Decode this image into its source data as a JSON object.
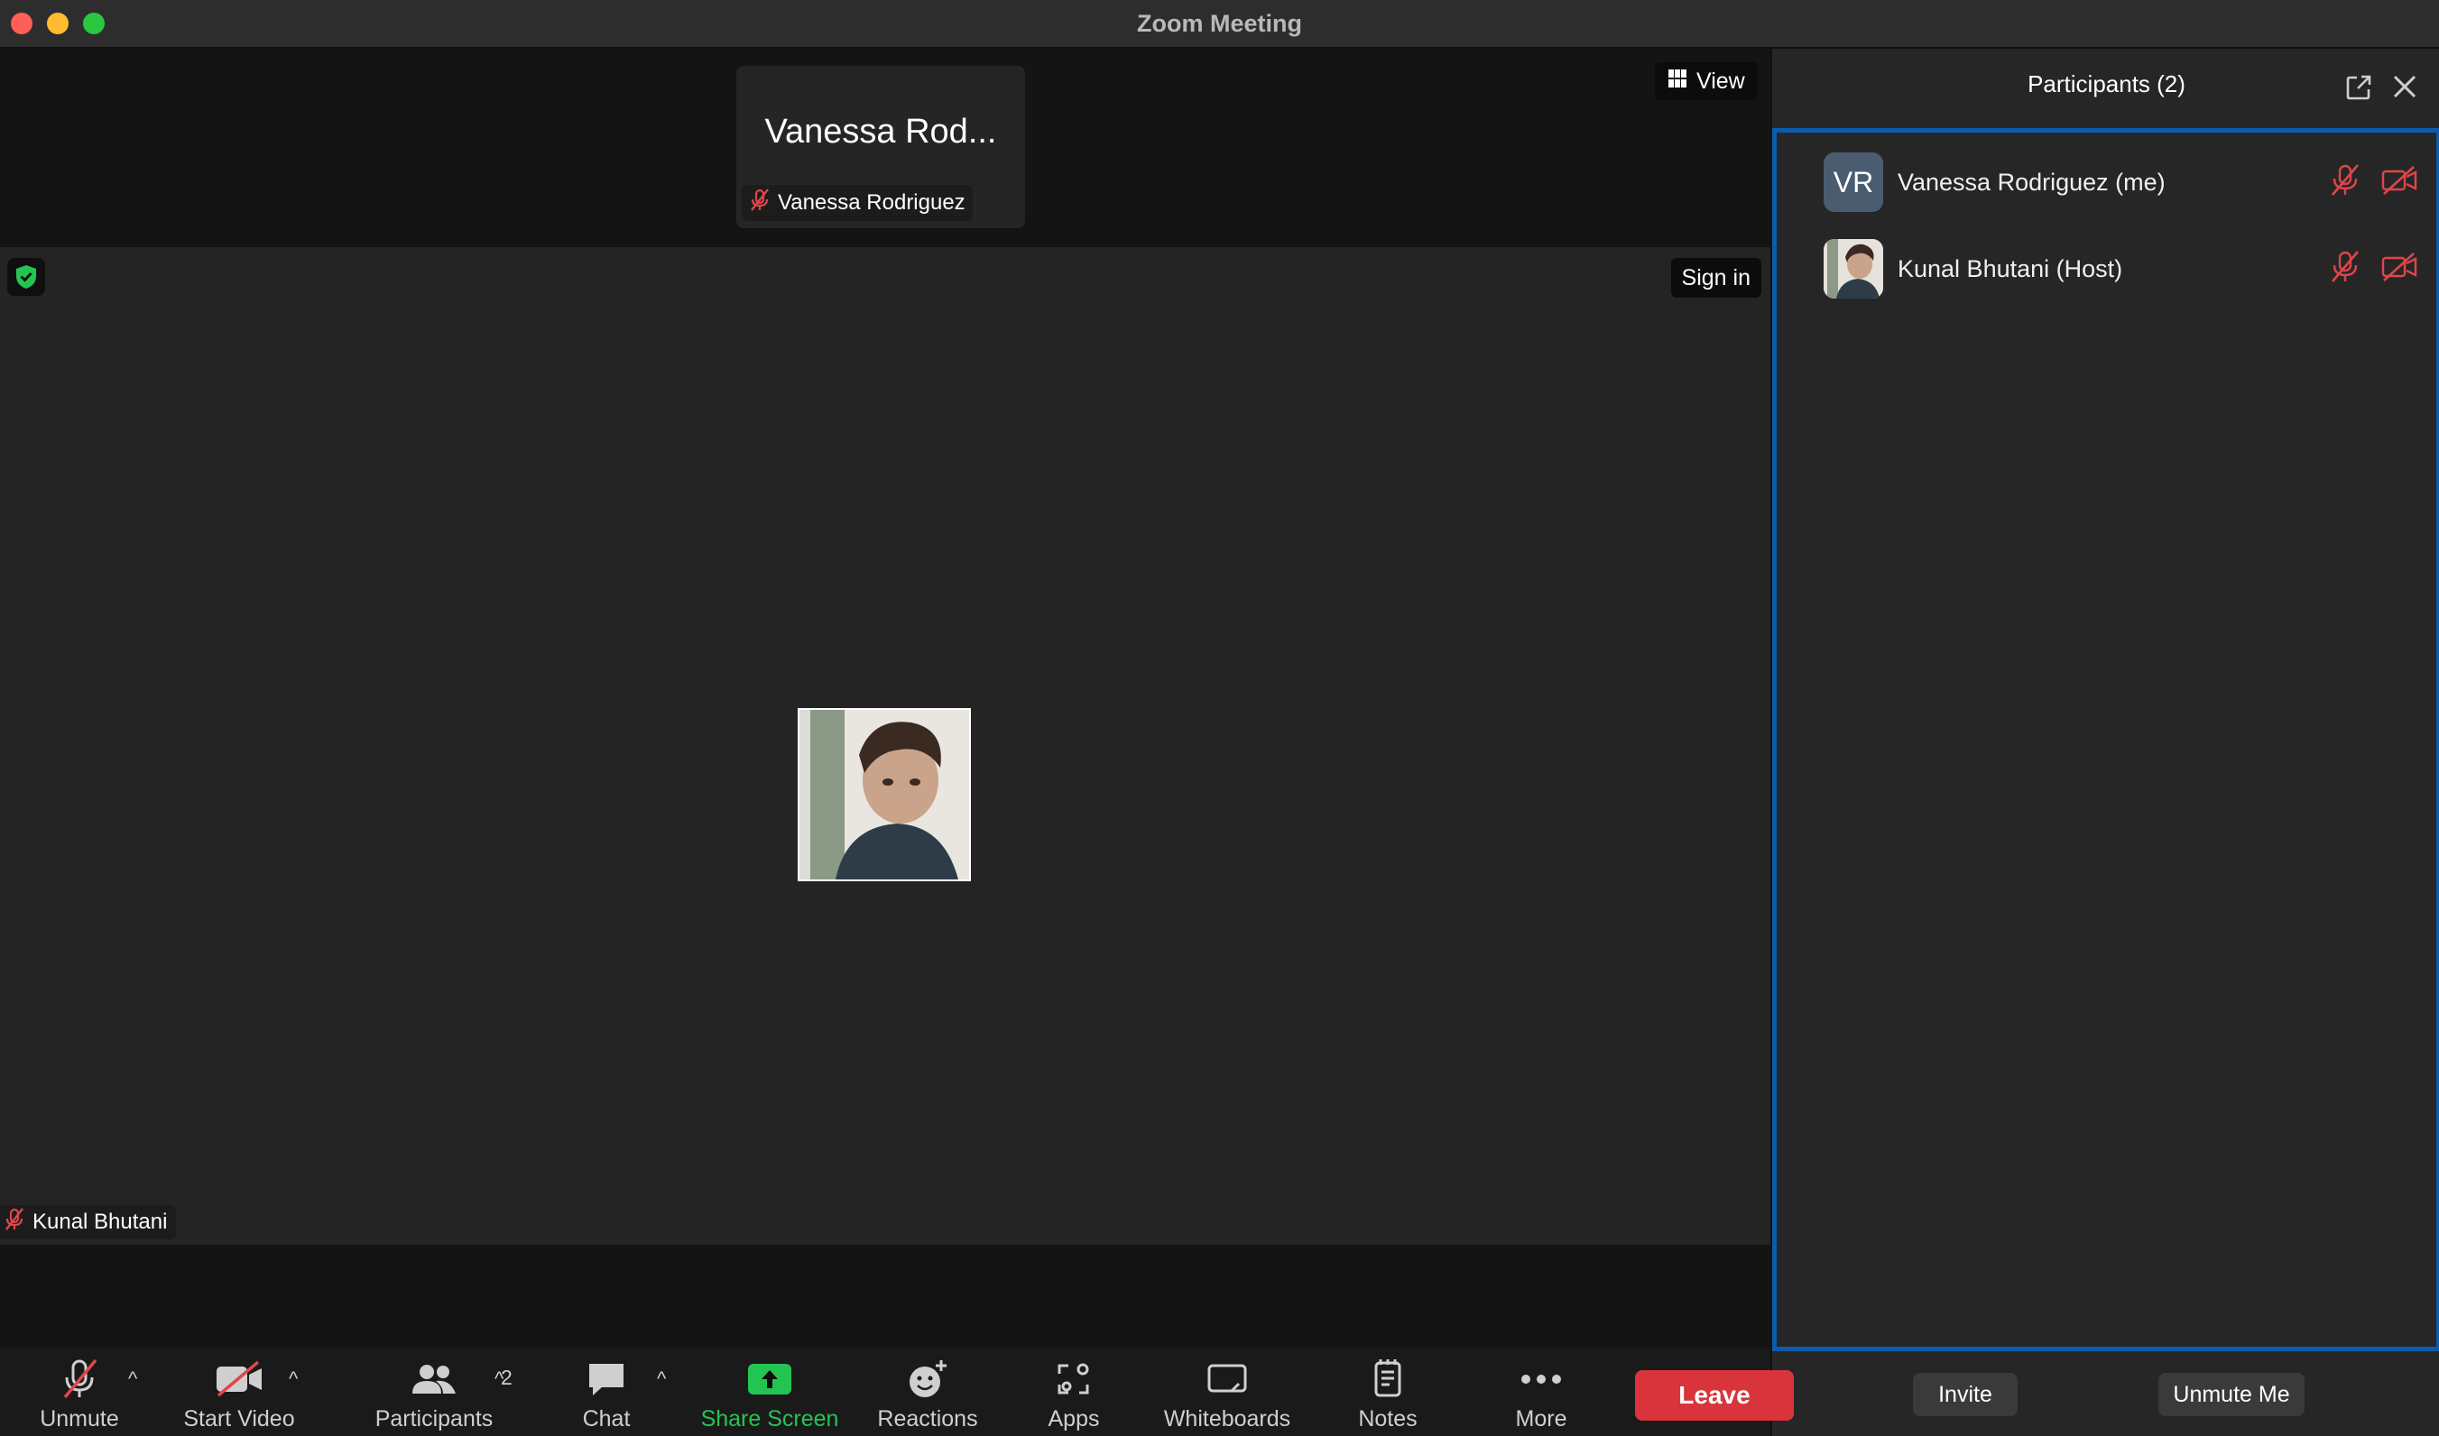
{
  "window": {
    "title": "Zoom Meeting"
  },
  "strip": {
    "tile_name": "Vanessa Rod...",
    "label_name": "Vanessa Rodriguez"
  },
  "view_button": {
    "label": "View"
  },
  "speaker": {
    "name": "Kunal Bhutani",
    "signin_label": "Sign in"
  },
  "toolbar": {
    "unmute": "Unmute",
    "start_video": "Start Video",
    "participants": "Participants",
    "participants_count": "2",
    "chat": "Chat",
    "share_screen": "Share Screen",
    "reactions": "Reactions",
    "apps": "Apps",
    "whiteboards": "Whiteboards",
    "notes": "Notes",
    "more": "More",
    "leave": "Leave"
  },
  "panel": {
    "title": "Participants (2)",
    "participants": [
      {
        "name": "Vanessa Rodriguez (me)",
        "initials": "VR"
      },
      {
        "name": "Kunal Bhutani (Host)",
        "initials": ""
      }
    ],
    "invite": "Invite",
    "unmute_me": "Unmute Me"
  },
  "colors": {
    "accent_blue": "#0b5cad",
    "share_green": "#23c552",
    "leave_red": "#d9333b",
    "muted_red": "#e0454a"
  },
  "icons": [
    "shield-check-icon",
    "grid-icon",
    "muted-mic-icon",
    "video-off-icon",
    "people-icon",
    "chat-bubble-icon",
    "upload-arrow-icon",
    "emoji-add-icon",
    "apps-icon",
    "whiteboard-icon",
    "notes-icon",
    "ellipsis-icon",
    "popout-icon",
    "close-icon"
  ]
}
